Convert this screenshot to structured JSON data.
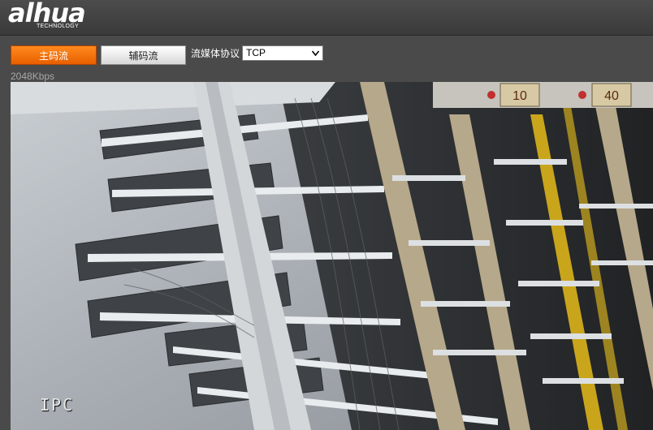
{
  "header": {
    "logo_text": "alhua",
    "logo_subtext": "TECHNOLOGY"
  },
  "toolbar": {
    "main_stream_label": "主码流",
    "sub_stream_label": "辅码流",
    "protocol_label": "流媒体协议",
    "protocol_value": "TCP"
  },
  "status": {
    "bitrate": "2048Kbps"
  },
  "video": {
    "osd_text": "IPC",
    "tag_left": "10",
    "tag_right": "40"
  },
  "colors": {
    "main_stream_active": "#f07010",
    "background": "#4a4a4a"
  }
}
